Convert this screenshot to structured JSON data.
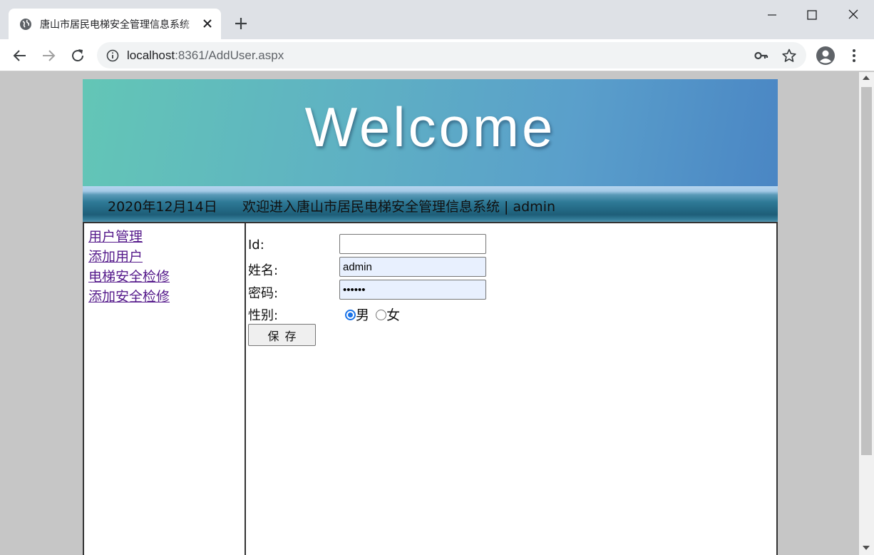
{
  "browser": {
    "tab_title": "唐山市居民电梯安全管理信息系统",
    "url_host": "localhost",
    "url_rest": ":8361/AddUser.aspx"
  },
  "page": {
    "banner_text": "Welcome",
    "date": "2020年12月14日",
    "welcome_message": "欢迎进入唐山市居民电梯安全管理信息系统 | admin"
  },
  "nav": {
    "items": [
      {
        "label": "用户管理"
      },
      {
        "label": "添加用户"
      },
      {
        "label": "电梯安全检修"
      },
      {
        "label": "添加安全检修"
      }
    ]
  },
  "form": {
    "id_label": "Id:",
    "id_value": "",
    "name_label": "姓名:",
    "name_value": "admin",
    "password_label": "密码:",
    "password_value": "••••••",
    "gender_label": "性别:",
    "gender_male": "男",
    "gender_female": "女",
    "gender_selected": "男",
    "save_label": "保存"
  },
  "colors": {
    "visited_link": "#551a8b",
    "radio_accent": "#1a73e8",
    "autofill_bg": "#e8f0fe"
  }
}
